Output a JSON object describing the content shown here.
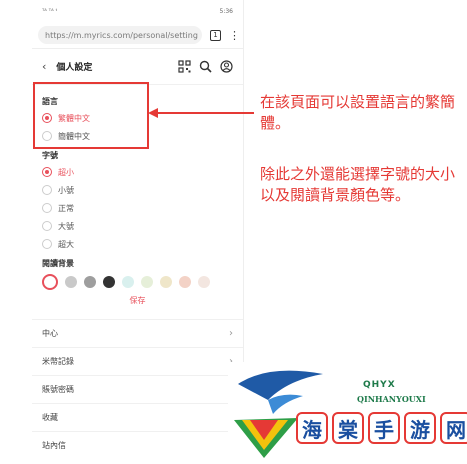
{
  "status": {
    "left": "ᵀᴬᵀᴬ ᵇ",
    "right": "5:36"
  },
  "browser": {
    "url": "https://m.myrics.com/personal/setting",
    "tabs": "1"
  },
  "header": {
    "back": "‹",
    "title": "個人設定"
  },
  "language": {
    "title": "語言",
    "options": [
      {
        "label": "繁體中文",
        "selected": true
      },
      {
        "label": "簡體中文",
        "selected": false
      }
    ]
  },
  "fontsize": {
    "title": "字號",
    "options": [
      {
        "label": "超小",
        "selected": true
      },
      {
        "label": "小號",
        "selected": false
      },
      {
        "label": "正常",
        "selected": false
      },
      {
        "label": "大號",
        "selected": false
      },
      {
        "label": "超大",
        "selected": false
      }
    ]
  },
  "background": {
    "title": "閱讀背景",
    "colors": [
      "#ffffff",
      "#c9c9c9",
      "#9e9e9e",
      "#333333",
      "#d9f0ee",
      "#e6efd9",
      "#efe6c9",
      "#f3d2c6",
      "#f3e6e0"
    ],
    "save": "保存"
  },
  "menu": [
    {
      "label": "中心"
    },
    {
      "label": "米幣記錄"
    },
    {
      "label": "賬號密碼"
    },
    {
      "label": "收藏"
    },
    {
      "label": "站內信"
    }
  ],
  "annotation": {
    "line1": "在該頁面可以設置語言的繁簡體。",
    "line2": "除此之外還能選擇字號的大小以及閱讀背景顏色等。"
  },
  "watermark": {
    "en": "QHYX",
    "en2": "QINHANYOUXI",
    "cn": [
      "海",
      "棠",
      "手",
      "游",
      "网"
    ]
  },
  "colors": {
    "accent": "#e8505b",
    "annotation": "#e53935"
  }
}
